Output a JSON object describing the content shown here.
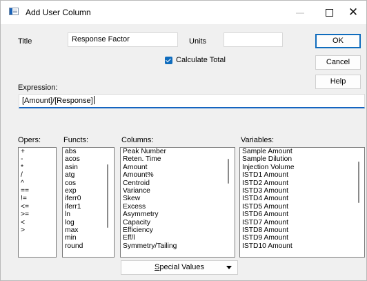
{
  "window": {
    "title": "Add User Column"
  },
  "fields": {
    "title_label": "Title",
    "title_value": "Response Factor",
    "units_label": "Units",
    "units_value": "",
    "calculate_total_label": "Calculate Total",
    "calculate_total_checked": true,
    "expression_label": "Expression:",
    "expression_value": "[Amount]/[Response]"
  },
  "buttons": {
    "ok": "OK",
    "cancel": "Cancel",
    "help": "Help"
  },
  "lists": {
    "opers_label": "Opers:",
    "opers": [
      "+",
      "-",
      "*",
      "/",
      "^",
      "==",
      "!=",
      "<=",
      ">=",
      "<",
      ">"
    ],
    "functs_label": "Functs:",
    "functs": [
      "abs",
      "acos",
      "asin",
      "atg",
      "cos",
      "exp",
      "iferr0",
      "iferr1",
      "ln",
      "log",
      "max",
      "min",
      "round"
    ],
    "columns_label": "Columns:",
    "columns": [
      "Peak Number",
      "Reten. Time",
      "Amount",
      "Amount%",
      "Centroid",
      "Variance",
      "Skew",
      "Excess",
      "Asymmetry",
      "Capacity",
      "Efficiency",
      "Eff/l",
      "Symmetry/Tailing"
    ],
    "variables_label": "Variables:",
    "variables": [
      "Sample Amount",
      "Sample Dilution",
      "Injection Volume",
      "ISTD1 Amount",
      "ISTD2 Amount",
      "ISTD3 Amount",
      "ISTD4 Amount",
      "ISTD5 Amount",
      "ISTD6 Amount",
      "ISTD7 Amount",
      "ISTD8 Amount",
      "ISTD9 Amount",
      "ISTD10 Amount"
    ]
  },
  "special_values": {
    "prefix": "",
    "underlined": "S",
    "rest": "pecial Values"
  }
}
